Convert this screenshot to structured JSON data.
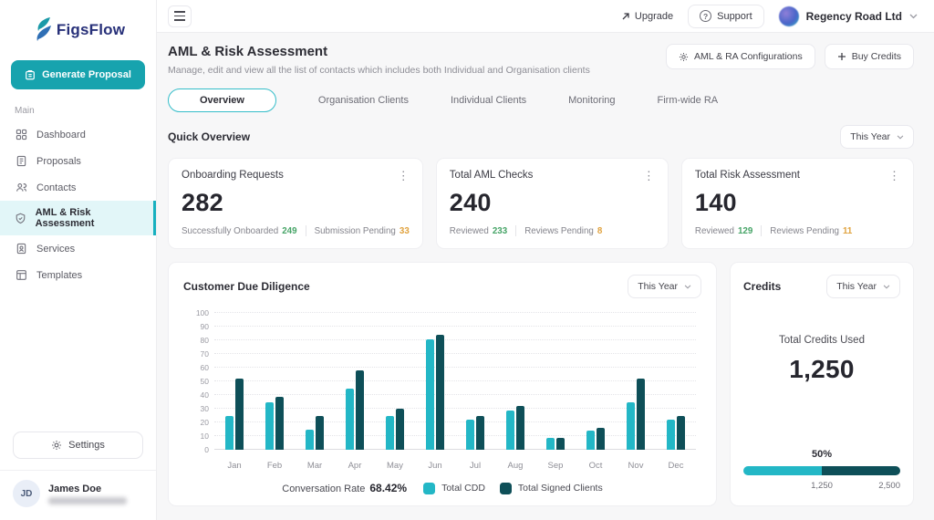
{
  "brand": {
    "name": "FigsFlow"
  },
  "sidebar": {
    "generate_proposal_label": "Generate Proposal",
    "section_label": "Main",
    "items": [
      {
        "label": "Dashboard",
        "icon": "dashboard-icon",
        "active": false
      },
      {
        "label": "Proposals",
        "icon": "proposals-icon",
        "active": false
      },
      {
        "label": "Contacts",
        "icon": "contacts-icon",
        "active": false
      },
      {
        "label": "AML & Risk Assessment",
        "icon": "aml-icon",
        "active": true
      },
      {
        "label": "Services",
        "icon": "services-icon",
        "active": false
      },
      {
        "label": "Templates",
        "icon": "templates-icon",
        "active": false
      }
    ],
    "settings_label": "Settings",
    "user": {
      "initials": "JD",
      "name": "James Doe"
    }
  },
  "topbar": {
    "upgrade_label": "Upgrade",
    "support_label": "Support",
    "company_name": "Regency Road Ltd"
  },
  "header": {
    "title": "AML & Risk Assessment",
    "subtitle": "Manage, edit and view all the list of contacts which includes both Individual and Organisation clients",
    "config_button": "AML & RA Configurations",
    "buy_credits_button": "Buy Credits"
  },
  "tabs": [
    {
      "label": "Overview",
      "active": true
    },
    {
      "label": "Organisation Clients",
      "active": false
    },
    {
      "label": "Individual Clients",
      "active": false
    },
    {
      "label": "Monitoring",
      "active": false
    },
    {
      "label": "Firm-wide RA",
      "active": false
    }
  ],
  "quick_overview": {
    "title": "Quick Overview",
    "period": "This Year"
  },
  "stat_cards": [
    {
      "title": "Onboarding Requests",
      "value": "282",
      "metrics": [
        {
          "label": "Successfully Onboarded",
          "value": "249",
          "color": "green"
        },
        {
          "label": "Submission Pending",
          "value": "33",
          "color": "orange"
        }
      ]
    },
    {
      "title": "Total AML Checks",
      "value": "240",
      "metrics": [
        {
          "label": "Reviewed",
          "value": "233",
          "color": "green"
        },
        {
          "label": "Reviews Pending",
          "value": "8",
          "color": "orange"
        }
      ]
    },
    {
      "title": "Total Risk Assessment",
      "value": "140",
      "metrics": [
        {
          "label": "Reviewed",
          "value": "129",
          "color": "green"
        },
        {
          "label": "Reviews Pending",
          "value": "11",
          "color": "orange"
        }
      ]
    }
  ],
  "chart_card": {
    "title": "Customer Due Diligence",
    "period": "This Year",
    "rate_label": "Conversation Rate",
    "rate_value": "68.42%"
  },
  "chart_data": {
    "type": "bar",
    "title": "Customer Due Diligence",
    "categories": [
      "Jan",
      "Feb",
      "Mar",
      "Apr",
      "May",
      "Jun",
      "Jul",
      "Aug",
      "Sep",
      "Oct",
      "Nov",
      "Dec"
    ],
    "series": [
      {
        "name": "Total CDD",
        "color": "#23b7c6",
        "values": [
          25,
          35,
          15,
          45,
          25,
          81,
          22,
          29,
          9,
          14,
          35,
          22
        ]
      },
      {
        "name": "Total Signed Clients",
        "color": "#0e4f58",
        "values": [
          52,
          39,
          25,
          58,
          30,
          84,
          25,
          32,
          9,
          16,
          52,
          25
        ]
      }
    ],
    "ylim": [
      0,
      100
    ],
    "yticks": [
      0,
      10,
      20,
      30,
      40,
      50,
      60,
      70,
      80,
      90,
      100
    ],
    "grid": true,
    "legend_position": "bottom"
  },
  "credits_card": {
    "title": "Credits",
    "period": "This Year",
    "total_label": "Total Credits Used",
    "total_value": "1,250",
    "percent_label": "50%",
    "segments": [
      {
        "color": "#23b7c6",
        "fraction": 0.5
      },
      {
        "color": "#0e4f58",
        "fraction": 0.5
      }
    ],
    "scale_mid": "1,250",
    "scale_max": "2,500"
  },
  "colors": {
    "accent": "#17a3ae",
    "green": "#46a467",
    "orange": "#e0a23e"
  }
}
